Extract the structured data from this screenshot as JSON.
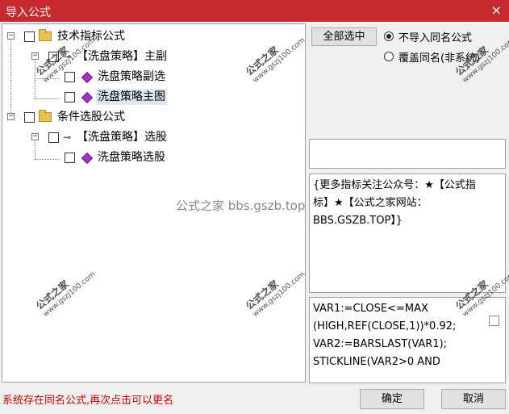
{
  "window": {
    "title": "导入公式",
    "close_glyph": "×"
  },
  "tree": {
    "nodes": [
      {
        "label": "技术指标公式",
        "checked": false,
        "type": "folder",
        "expanded": true
      },
      {
        "label": "【洗盘策略】主副",
        "checked": false,
        "type": "key",
        "expanded": true
      },
      {
        "label": "洗盘策略副选",
        "checked": false,
        "type": "diamond"
      },
      {
        "label": "洗盘策略主图",
        "checked": false,
        "type": "diamond",
        "selected": true
      },
      {
        "label": "条件选股公式",
        "checked": false,
        "type": "folder",
        "expanded": true
      },
      {
        "label": "【洗盘策略】选股",
        "checked": false,
        "type": "key",
        "expanded": true
      },
      {
        "label": "洗盘策略选股",
        "checked": false,
        "type": "diamond"
      }
    ]
  },
  "controls": {
    "select_all_label": "全部选中",
    "radio_options": [
      {
        "label": "不导入同名公式",
        "selected": true
      },
      {
        "label": "覆盖同名(非系统)",
        "selected": false
      }
    ]
  },
  "description": {
    "text": "{更多指标关注公众号：★【公式指标】★【公式之家网站：BBS.GSZB.TOP】}"
  },
  "code_preview": {
    "text": "VAR1:=CLOSE<=MAX\n(HIGH,REF(CLOSE,1))*0.92;\nVAR2:=BARSLAST(VAR1);\nSTICKLINE(VAR2>0 AND"
  },
  "status_message": "系统存在同名公式,再次点击可以更名",
  "buttons": {
    "ok": "确定",
    "cancel": "取消"
  },
  "watermarks": {
    "brand": "公式之家",
    "url": "www.gszj100.com",
    "center": "公式之家 bbs.gszb.top"
  },
  "colors": {
    "titlebar": "#c62a2f",
    "status_text": "#d00000"
  }
}
